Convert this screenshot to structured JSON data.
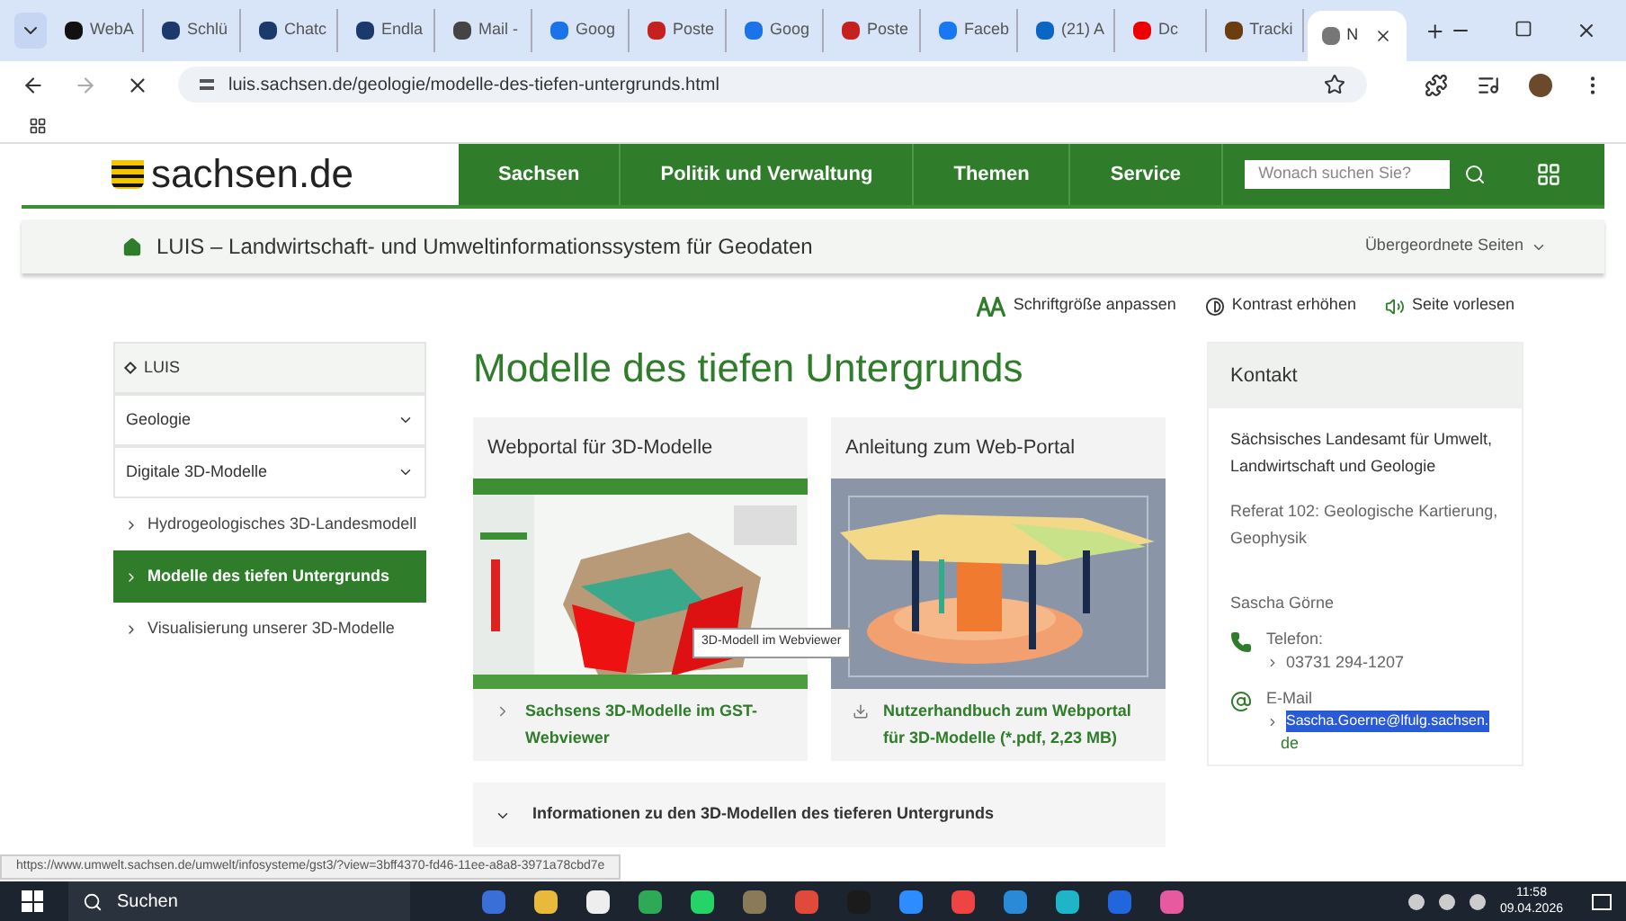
{
  "browser": {
    "tabs": [
      {
        "label": "WebA",
        "selected": false
      },
      {
        "label": "Schlü",
        "selected": false
      },
      {
        "label": "Chatc",
        "selected": false
      },
      {
        "label": "Endla",
        "selected": false
      },
      {
        "label": "Mail -",
        "selected": false
      },
      {
        "label": "Goog",
        "selected": false
      },
      {
        "label": "Poste",
        "selected": false
      },
      {
        "label": "Goog",
        "selected": false
      },
      {
        "label": "Poste",
        "selected": false
      },
      {
        "label": "Faceb",
        "selected": false
      },
      {
        "label": "(21) A",
        "selected": false
      },
      {
        "label": "Dc",
        "selected": false
      },
      {
        "label": "Tracki",
        "selected": false
      },
      {
        "label": "N",
        "selected": true
      }
    ],
    "url": "luis.sachsen.de/geologie/modelle-des-tiefen-untergrunds.html"
  },
  "site": {
    "logo": "sachsen.de",
    "nav": [
      "Sachsen",
      "Politik und Verwaltung",
      "Themen",
      "Service"
    ],
    "search": {
      "placeholder": "Wonach suchen Sie?"
    },
    "breadcrumb": "LUIS – Landwirtschaft- und Umweltinformationssystem für Geodaten",
    "parent_pages": "Übergeordnete Seiten",
    "accessibility": [
      {
        "kind": "font",
        "label": "Schriftgröße anpassen"
      },
      {
        "kind": "contrast",
        "label": "Kontrast erhöhen"
      },
      {
        "kind": "speaker",
        "label": "Seite vorlesen"
      }
    ]
  },
  "sidebar": {
    "items": [
      {
        "kind": "header",
        "label": "LUIS",
        "selected": false
      },
      {
        "kind": "dropdown",
        "label": "Geologie",
        "selected": false
      },
      {
        "kind": "dropdown",
        "label": "Digitale 3D-Modelle",
        "selected": false
      },
      {
        "kind": "link",
        "label": "Hydrogeologisches 3D-Landesmodell",
        "selected": false
      },
      {
        "kind": "link",
        "label": "Modelle des tiefen Untergrunds",
        "selected": true
      },
      {
        "kind": "link",
        "label": "Visualisierung unserer 3D-Modelle",
        "selected": false
      }
    ]
  },
  "title": "Modelle des tiefen Untergrunds",
  "cards": [
    {
      "title": "Webportal für 3D-Modelle",
      "kind": "link",
      "link": "Sachsens 3D-Modelle im GST-Webviewer",
      "tooltip": "3D-Modell im Webviewer"
    },
    {
      "title": "Anleitung zum Web-Portal",
      "kind": "download",
      "link": "Nutzerhandbuch zum Webportal für 3D-Modelle (*.pdf, 2,23 MB)"
    }
  ],
  "accordion": {
    "label": "Informationen zu den 3D-Modellen des tieferen Untergrunds"
  },
  "contact": {
    "title": "Kontakt",
    "org": "Sächsisches Landesamt für Umwelt, Landwirtschaft und Geologie",
    "unit": "Referat 102: Geologische Kartierung, Geophysik",
    "person": "Sascha Görne",
    "phone_label": "Telefon:",
    "phone": "03731 294-1207",
    "email_label": "E-Mail",
    "email_selected": "Sascha.Goerne@lfulg.sachsen.",
    "email_rest": "de"
  },
  "status_url": "https://www.umwelt.sachsen.de/umwelt/infosysteme/gst3/?view=3bff4370-fd46-11ee-a8a8-3971a78cbd7e",
  "taskbar": {
    "search": "Suchen",
    "time": "11:58",
    "date": "09.04.2026"
  }
}
